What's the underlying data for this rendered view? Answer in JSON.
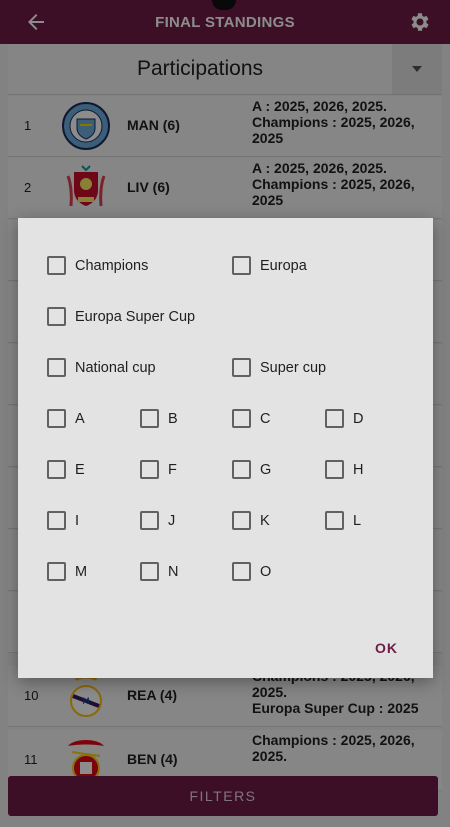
{
  "topbar": {
    "title": "FINAL STANDINGS"
  },
  "selector": {
    "label": "Participations"
  },
  "rows": [
    {
      "rank": "1",
      "team": "MAN (6)",
      "detail": "A : 2025, 2026, 2025.\nChampions : 2025, 2026, 2025"
    },
    {
      "rank": "2",
      "team": "LIV (6)",
      "detail": "A : 2025, 2026, 2025.\nChampions : 2025, 2026, 2025"
    },
    {
      "rank": "10",
      "team": "REA (4)",
      "detail": "Champions : 2025, 2026, 2025.\nEuropa Super Cup : 2025"
    },
    {
      "rank": "11",
      "team": "BEN (4)",
      "detail": "Champions : 2025, 2026, 2025."
    }
  ],
  "dialog": {
    "checkboxes": {
      "champions": "Champions",
      "europa": "Europa",
      "europa_super_cup": "Europa Super Cup",
      "national_cup": "National cup",
      "super_cup": "Super cup",
      "a": "A",
      "b": "B",
      "c": "C",
      "d": "D",
      "e": "E",
      "f": "F",
      "g": "G",
      "h": "H",
      "i": "I",
      "j": "J",
      "k": "K",
      "l": "L",
      "m": "M",
      "n": "N",
      "o": "O"
    },
    "ok_label": "OK"
  },
  "bottom": {
    "filters_label": "FILTERS"
  },
  "colors": {
    "brand": "#6d1d45"
  }
}
